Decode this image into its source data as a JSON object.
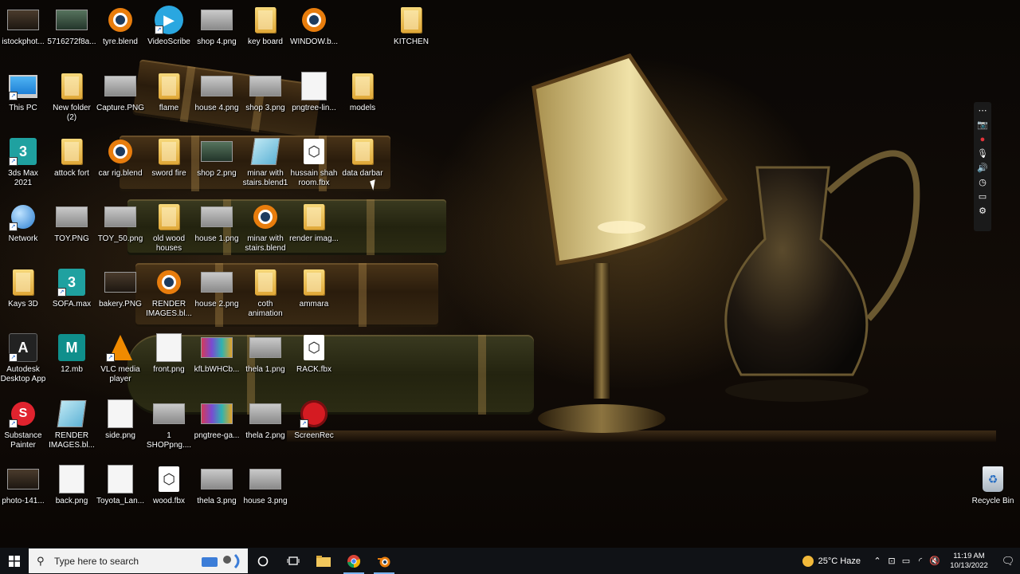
{
  "desktop": {
    "icons": [
      {
        "label": "istockphot...",
        "type": "thumb-dark"
      },
      {
        "label": "5716272f8a...",
        "type": "thumb-teal"
      },
      {
        "label": "tyre.blend",
        "type": "blender"
      },
      {
        "label": "VideoScribe",
        "type": "videoscribe"
      },
      {
        "label": "shop 4.png",
        "type": "thumb"
      },
      {
        "label": "key board",
        "type": "folder"
      },
      {
        "label": "WINDOW.b...",
        "type": "blender"
      },
      {
        "label": "KITCHEN",
        "type": "folder"
      },
      {
        "label": "This PC",
        "type": "thispc"
      },
      {
        "label": "New folder (2)",
        "type": "folder"
      },
      {
        "label": "Capture.PNG",
        "type": "thumb"
      },
      {
        "label": "flame",
        "type": "folder"
      },
      {
        "label": "house 4.png",
        "type": "thumb"
      },
      {
        "label": "shop 3.png",
        "type": "thumb"
      },
      {
        "label": "pngtree-lin...",
        "type": "thumb-page"
      },
      {
        "label": "models",
        "type": "folder"
      },
      {
        "label": "3ds Max 2021",
        "type": "3dsmax"
      },
      {
        "label": "attock fort",
        "type": "folder"
      },
      {
        "label": "car rig.blend",
        "type": "blender"
      },
      {
        "label": "sword fire",
        "type": "folder"
      },
      {
        "label": "shop 2.png",
        "type": "thumb-teal"
      },
      {
        "label": "minar with stairs.blend1",
        "type": "blend1"
      },
      {
        "label": "hussain shah room.fbx",
        "type": "fbx"
      },
      {
        "label": "data darbar",
        "type": "folder"
      },
      {
        "label": "Network",
        "type": "network"
      },
      {
        "label": "TOY.PNG",
        "type": "thumb"
      },
      {
        "label": "TOY_50.png",
        "type": "thumb"
      },
      {
        "label": "old wood houses",
        "type": "folder"
      },
      {
        "label": "house 1.png",
        "type": "thumb"
      },
      {
        "label": "minar with stairs.blend",
        "type": "blender"
      },
      {
        "label": "render imag...",
        "type": "folder"
      },
      {
        "label": "Kays 3D",
        "type": "folder"
      },
      {
        "label": "SOFA.max",
        "type": "3dsmax"
      },
      {
        "label": "bakery.PNG",
        "type": "thumb-dark"
      },
      {
        "label": "RENDER IMAGES.bl...",
        "type": "blender"
      },
      {
        "label": "house 2.png",
        "type": "thumb"
      },
      {
        "label": "coth animation",
        "type": "folder"
      },
      {
        "label": "ammara",
        "type": "folder"
      },
      {
        "label": "Autodesk Desktop App",
        "type": "autodesk"
      },
      {
        "label": "12.mb",
        "type": "maya"
      },
      {
        "label": "VLC media player",
        "type": "vlc"
      },
      {
        "label": "front.png",
        "type": "thumb-page"
      },
      {
        "label": "kfLbWHCb...",
        "type": "thumb-grad"
      },
      {
        "label": "thela 1.png",
        "type": "thumb"
      },
      {
        "label": "RACK.fbx",
        "type": "fbx"
      },
      {
        "label": "Substance Painter",
        "type": "substance"
      },
      {
        "label": "RENDER IMAGES.bl...",
        "type": "blend1"
      },
      {
        "label": "side.png",
        "type": "thumb-page"
      },
      {
        "label": "1 SHOPpng....",
        "type": "thumb"
      },
      {
        "label": "pngtree-ga...",
        "type": "thumb-grad"
      },
      {
        "label": "thela 2.png",
        "type": "thumb"
      },
      {
        "label": "ScreenRec",
        "type": "screenrec"
      },
      {
        "label": "photo-141...",
        "type": "thumb-dark"
      },
      {
        "label": "back.png",
        "type": "thumb-page"
      },
      {
        "label": "Toyota_Lan...",
        "type": "thumb-page"
      },
      {
        "label": "wood.fbx",
        "type": "fbx"
      },
      {
        "label": "thela 3.png",
        "type": "thumb"
      },
      {
        "label": "house 3.png",
        "type": "thumb"
      },
      {
        "label": "Recycle Bin",
        "type": "recycle"
      }
    ]
  },
  "taskbar": {
    "search_placeholder": "Type here to search",
    "weather": "25°C  Haze",
    "time": "11:19 AM",
    "date": "10/13/2022",
    "pinned": [
      "cortana-circle",
      "task-view",
      "file-explorer",
      "chrome",
      "blender"
    ]
  },
  "colors": {
    "accent": "#7ab4f0",
    "blender": "#e87d0d",
    "folder": "#f2c75c"
  }
}
